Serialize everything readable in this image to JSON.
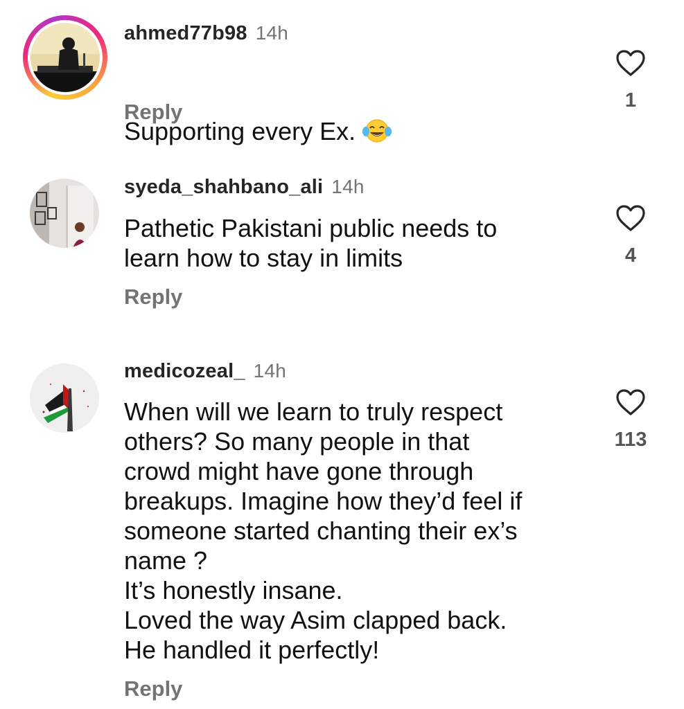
{
  "comments": [
    {
      "username": "ahmed77b98",
      "time": "14h",
      "text": "Supporting every Ex.",
      "emoji": "laughing-tears-emoji",
      "reply_label": "Reply",
      "likes": "1",
      "has_story_ring": true
    },
    {
      "username": "syeda_shahbano_ali",
      "time": "14h",
      "text": "Pathetic Pakistani public needs to\nlearn how to stay in limits",
      "reply_label": "Reply",
      "likes": "4",
      "has_story_ring": false
    },
    {
      "username": "medicozeal_",
      "time": "14h",
      "text": "When will we learn to truly respect\nothers? So many people in that\ncrowd might have gone through\nbreakups. Imagine how they’d feel if\nsomeone started chanting their ex’s\nname ?\nIt’s honestly insane.\nLoved the way Asim clapped back.\nHe handled it perfectly!",
      "reply_label": "Reply",
      "likes": "113",
      "has_story_ring": false
    }
  ],
  "icons": {
    "like": "heart-outline-icon"
  },
  "colors": {
    "text": "#111111",
    "meta": "#737373",
    "username": "#262626"
  }
}
